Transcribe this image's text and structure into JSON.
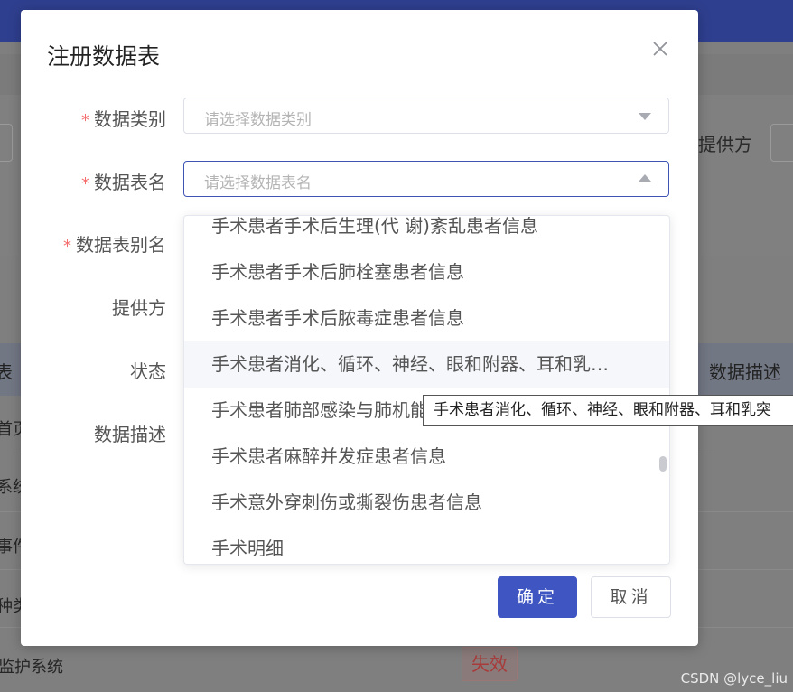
{
  "background": {
    "provider_label": "提供方",
    "table_header_left": "表",
    "table_header_desc": "数据描述",
    "rows": [
      "首页",
      "系统",
      "事件",
      "种类",
      "监护系统"
    ],
    "status_badge": "失效",
    "watermark": "CSDN @lyce_liu"
  },
  "dialog": {
    "title": "注册数据表",
    "fields": {
      "category": {
        "label": "数据类别",
        "placeholder": "请选择数据类别"
      },
      "table_name": {
        "label": "数据表名",
        "placeholder": "请选择数据表名"
      },
      "alias": {
        "label": "数据表别名"
      },
      "provider": {
        "label": "提供方"
      },
      "status": {
        "label": "状态"
      },
      "description": {
        "label": "数据描述"
      }
    },
    "confirm_label": "确定",
    "cancel_label": "取消"
  },
  "dropdown": {
    "options": [
      "手术患者手术后生理(代 谢)紊乱患者信息",
      "手术患者手术后肺栓塞患者信息",
      "手术患者手术后脓毒症患者信息",
      "手术患者消化、循环、神经、眼和附器、耳和乳…",
      "手术患者肺部感染与肺机能",
      "手术患者麻醉并发症患者信息",
      "手术意外穿刺伤或撕裂伤患者信息",
      "手术明细"
    ],
    "hovered_index": 3
  },
  "tooltip": {
    "text": "手术患者消化、循环、神经、眼和附器、耳和乳突"
  },
  "colors": {
    "primary": "#3e55c2",
    "required": "#f56c6c",
    "header_bar": "#2f3f8f",
    "overlay": "#7f7f7f"
  }
}
